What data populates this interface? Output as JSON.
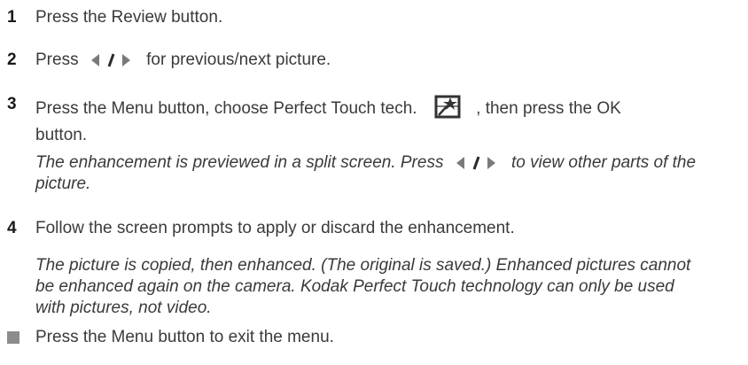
{
  "steps": [
    {
      "number": "1",
      "text": "Press the Review button."
    },
    {
      "number": "2",
      "text_before": "Press",
      "text_after": "for previous/next picture."
    },
    {
      "number": "3",
      "text_before": "Press the Menu button, choose Perfect Touch tech.",
      "text_after": ", then press the OK",
      "text_line2": "button.",
      "note_before": "The enhancement is previewed in a split screen. Press",
      "note_after": "to view other parts of the",
      "note_line2": "picture."
    },
    {
      "number": "4",
      "text": "Follow the screen prompts to apply or discard the enhancement.",
      "note_lines": [
        "The picture is copied, then enhanced. (The original is saved.) Enhanced pictures cannot",
        "be enhanced again on the camera. Kodak Perfect Touch technology can only be used",
        "with pictures, not video."
      ]
    }
  ],
  "bullet": {
    "text": "Press the Menu button to exit the menu."
  },
  "icons": {
    "left_right": "left-right-arrows-icon",
    "perfect_touch": "perfect-touch-icon"
  }
}
